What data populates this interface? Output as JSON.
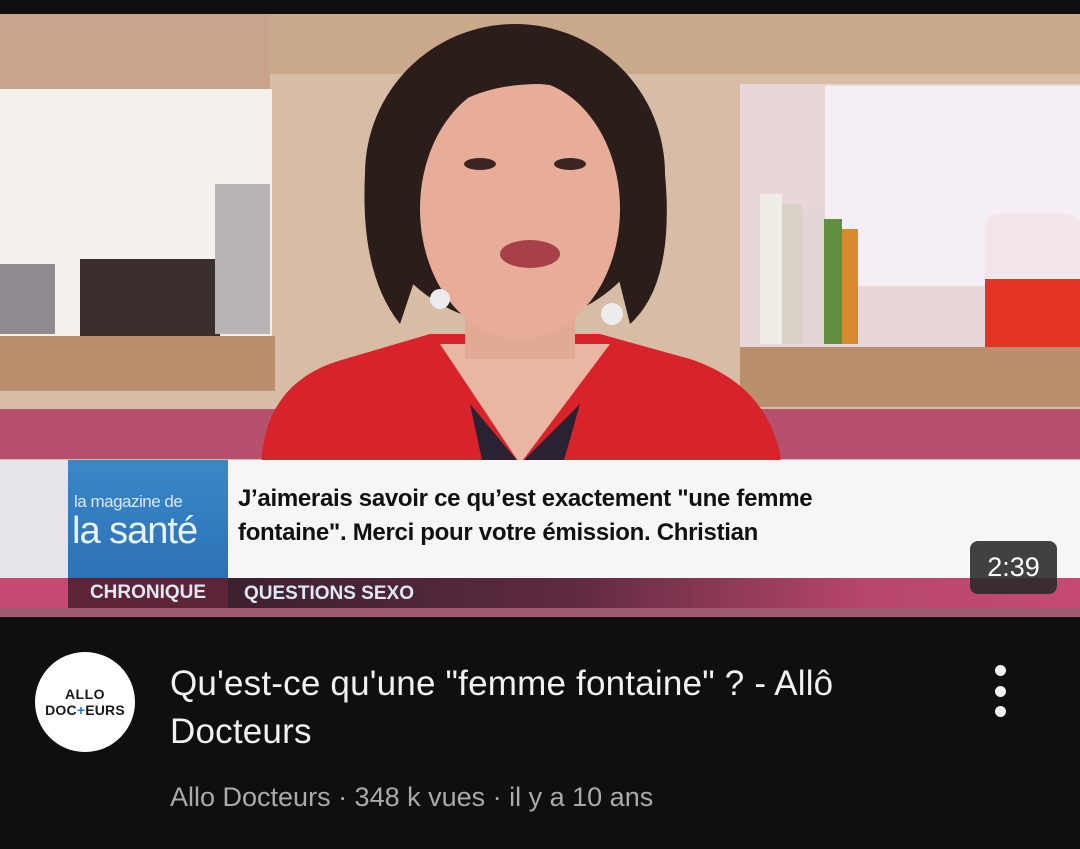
{
  "video": {
    "caption": {
      "logo_top": "la magazine de",
      "logo_bottom": "la santé",
      "quote_line1": "J’aimerais savoir ce qu’est exactement \"une femme",
      "quote_line2": "fontaine\". Merci pour votre émission. Christian",
      "category": "CHRONIQUE",
      "topic": "QUESTIONS SEXO"
    },
    "duration": "2:39"
  },
  "channel": {
    "avatar_line1": "ALLO",
    "avatar_line2_a": "DOC",
    "avatar_line2_plus": "+",
    "avatar_line2_b": "EURS"
  },
  "details": {
    "title": "Qu'est-ce qu'une \"femme fontaine\" ? - Allô Docteurs",
    "meta": "Allo Docteurs · 348 k vues · il y a 10 ans"
  },
  "colors": {
    "background": "#0f0f0f",
    "title_text": "#f1f1f1",
    "meta_text": "#aaaaaa",
    "jacket": "#d8232a",
    "logo_blue": "#2f7bbf"
  },
  "icons": {
    "more": "vertical-ellipsis"
  }
}
